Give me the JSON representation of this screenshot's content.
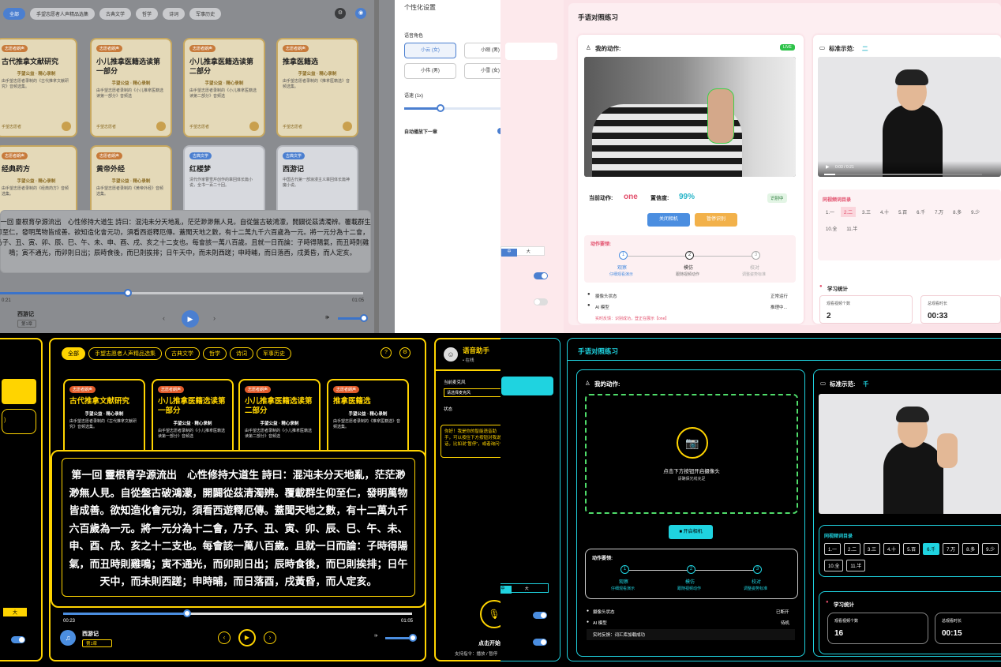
{
  "q1": {
    "tabs": [
      "全部",
      "手望志愿者人声精品选集",
      "古典文学",
      "哲学",
      "诗词",
      "军事历史"
    ],
    "cards": [
      {
        "badge": "志愿者朗声",
        "title": "古代推拿文献研究",
        "sub": "手望公益 · 精心录制",
        "desc": "由手望志愿者录制的《古代推拿文献研究》音频选集。",
        "foot": "手望志愿者"
      },
      {
        "badge": "志愿者朗声",
        "title": "小儿推拿医籍选读第一部分",
        "sub": "手望公益 · 精心录制",
        "desc": "由手望志愿者录制的《小儿推拿医籍选读第一部分》音频选",
        "foot": "手望志愿者"
      },
      {
        "badge": "志愿者朗声",
        "title": "小儿推拿医籍选读第二部分",
        "sub": "手望公益 · 精心录制",
        "desc": "由手望志愿者录制的《小儿推拿医籍选读第二部分》音频选",
        "foot": "手望志愿者"
      },
      {
        "badge": "志愿者朗声",
        "title": "推拿医籍选",
        "sub": "手望公益 · 精心录制",
        "desc": "由手望志愿者录制的《推拿医籍选》音频选集。",
        "foot": "手望志愿者"
      },
      {
        "badge": "志愿者朗声",
        "title": "经典药方",
        "sub": "手望公益 · 精心录制",
        "desc": "由手望志愿者录制的《经典药方》音频选集。"
      },
      {
        "badge": "志愿者朗声",
        "title": "黄帝外经",
        "sub": "手望公益 · 精心录制",
        "desc": "由手望志愿者录制的《黄帝外经》音频选集。"
      },
      {
        "badge": "古典文学",
        "title": "红楼梦",
        "desc": "清代作家曹雪芹创作的章回体长篇小说，全书一百二十回。"
      },
      {
        "badge": "古典文学",
        "title": "西游记",
        "desc": "中国古代第一部浪漫主义章回体长篇神魔小说。"
      }
    ],
    "reading_text": "第一回 靈根育孕源流出　心性修持大道生 詩曰：混沌未分天地亂，茫茫渺渺無人見。自從盤古破鴻濛，開闢從茲清濁辨。覆載群生仰至仁，發明萬物皆成善。欲知造化會元功，須看西遊釋厄傳。蓋聞天地之數，有十二萬九千六百歲為一元。將一元分為十二會，乃子、丑、寅、卯、辰、巳、午、未、申、酉、戌、亥之十二支也。每會該一萬八百歲。且就一日而論：子時得陽氣，而丑時則雞鳴；寅不通光，而卯則日出；辰時食後，而巳則挨排；日午天中，而未則西蹉；申時晡，而日落酉，戌黃昏，而人定亥。",
    "time_cur": "0:21",
    "time_total": "01:05",
    "progress": 0.35,
    "book": "西游记",
    "chapter": "第1章",
    "settings": {
      "title": "个性化设置",
      "voice_label": "语音角色",
      "voices": [
        "小云 (女)",
        "小刚 (男)",
        "小伟 (男)",
        "小雪 (女)"
      ],
      "speed_label": "语速 (1x)",
      "speed": 0.37,
      "autoplay_label": "自动播放下一章"
    },
    "size_labels": [
      "中",
      "大"
    ]
  },
  "q2": {
    "title": "手语对照练习",
    "my_action": "我的动作:",
    "live": "LIVE",
    "standard": "标准示范:",
    "standard_sign": "二",
    "video_time": "0:03 / 0:21",
    "current_action_label": "当前动作:",
    "current_action": "one",
    "confidence_label": "置信度:",
    "confidence": "99%",
    "recognizing": "识别中",
    "btn_close_cam": "关闭相机",
    "btn_pause": "暂停识别",
    "req_title": "动作要领:",
    "steps": [
      {
        "n": "1",
        "label": "观察",
        "hint": "仔细观看演示"
      },
      {
        "n": "2",
        "label": "模仿",
        "hint": "跟随视频动作"
      },
      {
        "n": "3",
        "label": "校对",
        "hint": "调整姿势标准"
      }
    ],
    "camera_status_label": "摄像头状态",
    "camera_status": "正常运行",
    "ai_label": "AI 模型",
    "ai_status": "推理中...",
    "feedback": "实时反馈：识别成功，登正在展示【one】",
    "vocab_title": "同视频词目录",
    "vocab": [
      "1.一",
      "2.二",
      "3.三",
      "4.十",
      "5.百",
      "6.千",
      "7.万",
      "8.多",
      "9.少",
      "10.全",
      "11.半"
    ],
    "vocab_selected": 1,
    "stats_title": "学习统计",
    "stat1_label": "观看视频个数",
    "stat1": "2",
    "stat2_label": "总观看时长",
    "stat2": "00:33"
  },
  "q3": {
    "tabs": [
      "全部",
      "手望志愿者人声精品选集",
      "古典文学",
      "哲学",
      "诗词",
      "军事历史"
    ],
    "cards": [
      {
        "badge": "志愿者朗声",
        "title": "古代推拿文献研究",
        "sub": "手望公益 · 精心录制",
        "desc": "由手望志愿者录制的《古代推拿文献研究》音频选集。"
      },
      {
        "badge": "志愿者朗声",
        "title": "小儿推拿医籍选读第一部分",
        "sub": "手望公益 · 精心录制",
        "desc": "由手望志愿者录制的《小儿推拿医籍选读第一部分》音频选"
      },
      {
        "badge": "志愿者朗声",
        "title": "小儿推拿医籍选读第二部分",
        "sub": "手望公益 · 精心录制",
        "desc": "由手望志愿者录制的《小儿推拿医籍选读第二部分》音频选"
      },
      {
        "badge": "志愿者朗声",
        "title": "推拿医籍选",
        "sub": "手望公益 · 精心录制",
        "desc": "由手望志愿者录制的《推拿医籍选》音频选集。"
      }
    ],
    "reading_text": "第一回 靈根育孕源流出　心性修持大道生 詩曰：混沌未分天地亂，茫茫渺渺無人見。自從盤古破鴻濛，開闢從茲清濁辨。覆載群生仰至仁，發明萬物皆成善。欲知造化會元功，須看西遊釋厄傳。蓋聞天地之數，有十二萬九千六百歲為一元。將一元分為十二會，乃子、丑、寅、卯、辰、巳、午、未、申、酉、戌、亥之十二支也。每會該一萬八百歲。且就一日而論：子時得陽氣，而丑時則雞鳴；寅不通光，而卯則日出；辰時食後，而巳則挨排；日午天中，而未則西蹉；申時晡，而日落酉，戌黃昏，而人定亥。",
    "time_cur": "00:23",
    "time_total": "01:05",
    "progress": 0.35,
    "book": "西游记",
    "chapter": "第1章",
    "assistant": {
      "title": "语音助手",
      "status": "• 在线",
      "mic_label": "当前麦克风",
      "mic_value": "请选择麦克风",
      "state_label": "状态",
      "message": "你好！我是你的智能语音助手，可以按住下方按钮对我说话，比如说“暂停”，或者询问书",
      "start": "点击开始",
      "hint": "支持指令：播放 / 暂停"
    },
    "size_labels": [
      "大"
    ]
  },
  "q4": {
    "title": "手语对照练习",
    "my_action": "我的动作:",
    "standard": "标准示范:",
    "standard_sign": "千",
    "cam_prompt": "点击下方按钮开启摄像头",
    "cam_hint": "请确保光线充足",
    "btn_open_cam": "开启相机",
    "req_title": "动作要领:",
    "steps": [
      {
        "n": "1",
        "label": "观察",
        "hint": "仔细观看演示"
      },
      {
        "n": "2",
        "label": "模仿",
        "hint": "跟随视频动作"
      },
      {
        "n": "3",
        "label": "校对",
        "hint": "调整姿势标准"
      }
    ],
    "camera_status_label": "摄像头状态",
    "camera_status": "已断开",
    "ai_label": "AI 模型",
    "ai_status": "待机",
    "feedback": "实时反馈：词汇库加载成功",
    "vocab_title": "同视频词目录",
    "vocab": [
      "1.一",
      "2.二",
      "3.三",
      "4.十",
      "5.百",
      "6.千",
      "7.万",
      "8.多",
      "9.少",
      "10.全",
      "11.半"
    ],
    "vocab_selected": 5,
    "stats_title": "学习统计",
    "stat1_label": "观看视频个数",
    "stat1": "16",
    "stat2_label": "总观看时长",
    "stat2": "00:15",
    "size_labels": [
      "中",
      "大"
    ]
  },
  "colors": {
    "q1_accent": "#4b7fd0",
    "q2_accent": "#e24d6a",
    "q3_accent": "#ffd400",
    "q4_accent": "#1fd3e0"
  }
}
